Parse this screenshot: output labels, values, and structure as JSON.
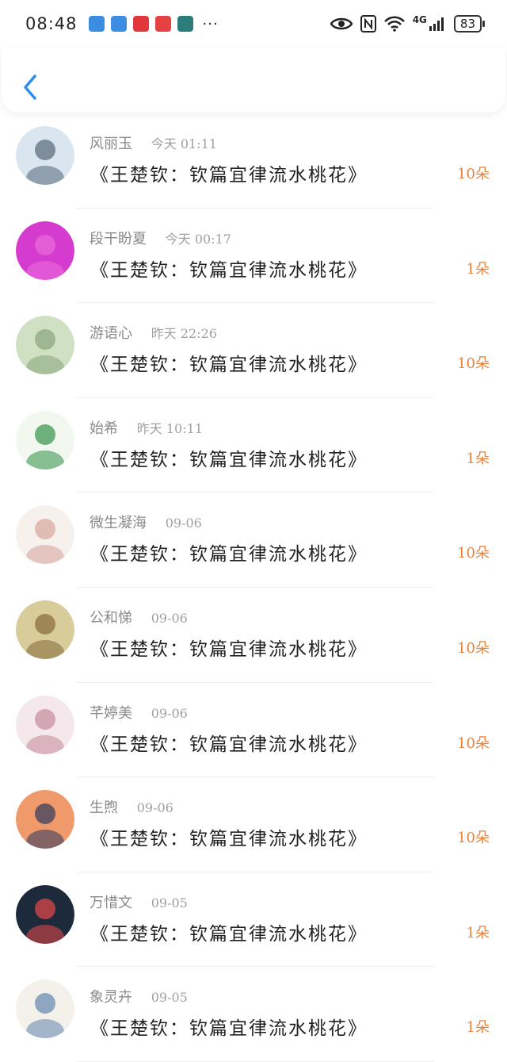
{
  "status_bar": {
    "time": "08:48",
    "dots": "···",
    "network": "4G",
    "battery": "83",
    "icons": [
      "eye-icon",
      "nfc-icon",
      "wifi-icon",
      "signal-icon"
    ],
    "app_icon_colors": [
      "#3a8de0",
      "#3a8de0",
      "#e0363c",
      "#e64141",
      "#2c7d7a"
    ]
  },
  "header": {
    "back_icon": "chevron-left-icon",
    "accent": "#2f8fe4"
  },
  "accent_color": "#e8823a",
  "items": [
    {
      "name": "风丽玉",
      "date": "今天 01:11",
      "title": "《王楚钦：钦篇宜律流水桃花》",
      "amount": "10朵",
      "avatar_colors": [
        "#d9e5ef",
        "#5d6f80"
      ]
    },
    {
      "name": "段干盼夏",
      "date": "今天 00:17",
      "title": "《王楚钦：钦篇宜律流水桃花》",
      "amount": "1朵",
      "avatar_colors": [
        "#d63bd0",
        "#e76ad8"
      ]
    },
    {
      "name": "游语心",
      "date": "昨天 22:26",
      "title": "《王楚钦：钦篇宜律流水桃花》",
      "amount": "10朵",
      "avatar_colors": [
        "#cfe0c3",
        "#8da880"
      ]
    },
    {
      "name": "始希",
      "date": "昨天 10:11",
      "title": "《王楚钦：钦篇宜律流水桃花》",
      "amount": "1朵",
      "avatar_colors": [
        "#f2f7ef",
        "#3f9a55"
      ]
    },
    {
      "name": "微生凝海",
      "date": "09-06",
      "title": "《王楚钦：钦篇宜律流水桃花》",
      "amount": "10朵",
      "avatar_colors": [
        "#f7f1ee",
        "#d8a9a1"
      ]
    },
    {
      "name": "公和悌",
      "date": "09-06",
      "title": "《王楚钦：钦篇宜律流水桃花》",
      "amount": "10朵",
      "avatar_colors": [
        "#d8cc9a",
        "#8b6f41"
      ]
    },
    {
      "name": "芊婷美",
      "date": "09-06",
      "title": "《王楚钦：钦篇宜律流水桃花》",
      "amount": "10朵",
      "avatar_colors": [
        "#f4e8ec",
        "#c98fa0"
      ]
    },
    {
      "name": "生煦",
      "date": "09-06",
      "title": "《王楚钦：钦篇宜律流水桃花》",
      "amount": "10朵",
      "avatar_colors": [
        "#f09a6b",
        "#3b3f5e"
      ]
    },
    {
      "name": "万惜文",
      "date": "09-05",
      "title": "《王楚钦：钦篇宜律流水桃花》",
      "amount": "1朵",
      "avatar_colors": [
        "#1c2a3c",
        "#d94848"
      ]
    },
    {
      "name": "象灵卉",
      "date": "09-05",
      "title": "《王楚钦：钦篇宜律流水桃花》",
      "amount": "1朵",
      "avatar_colors": [
        "#f4f0ea",
        "#6c8eb0"
      ]
    }
  ]
}
